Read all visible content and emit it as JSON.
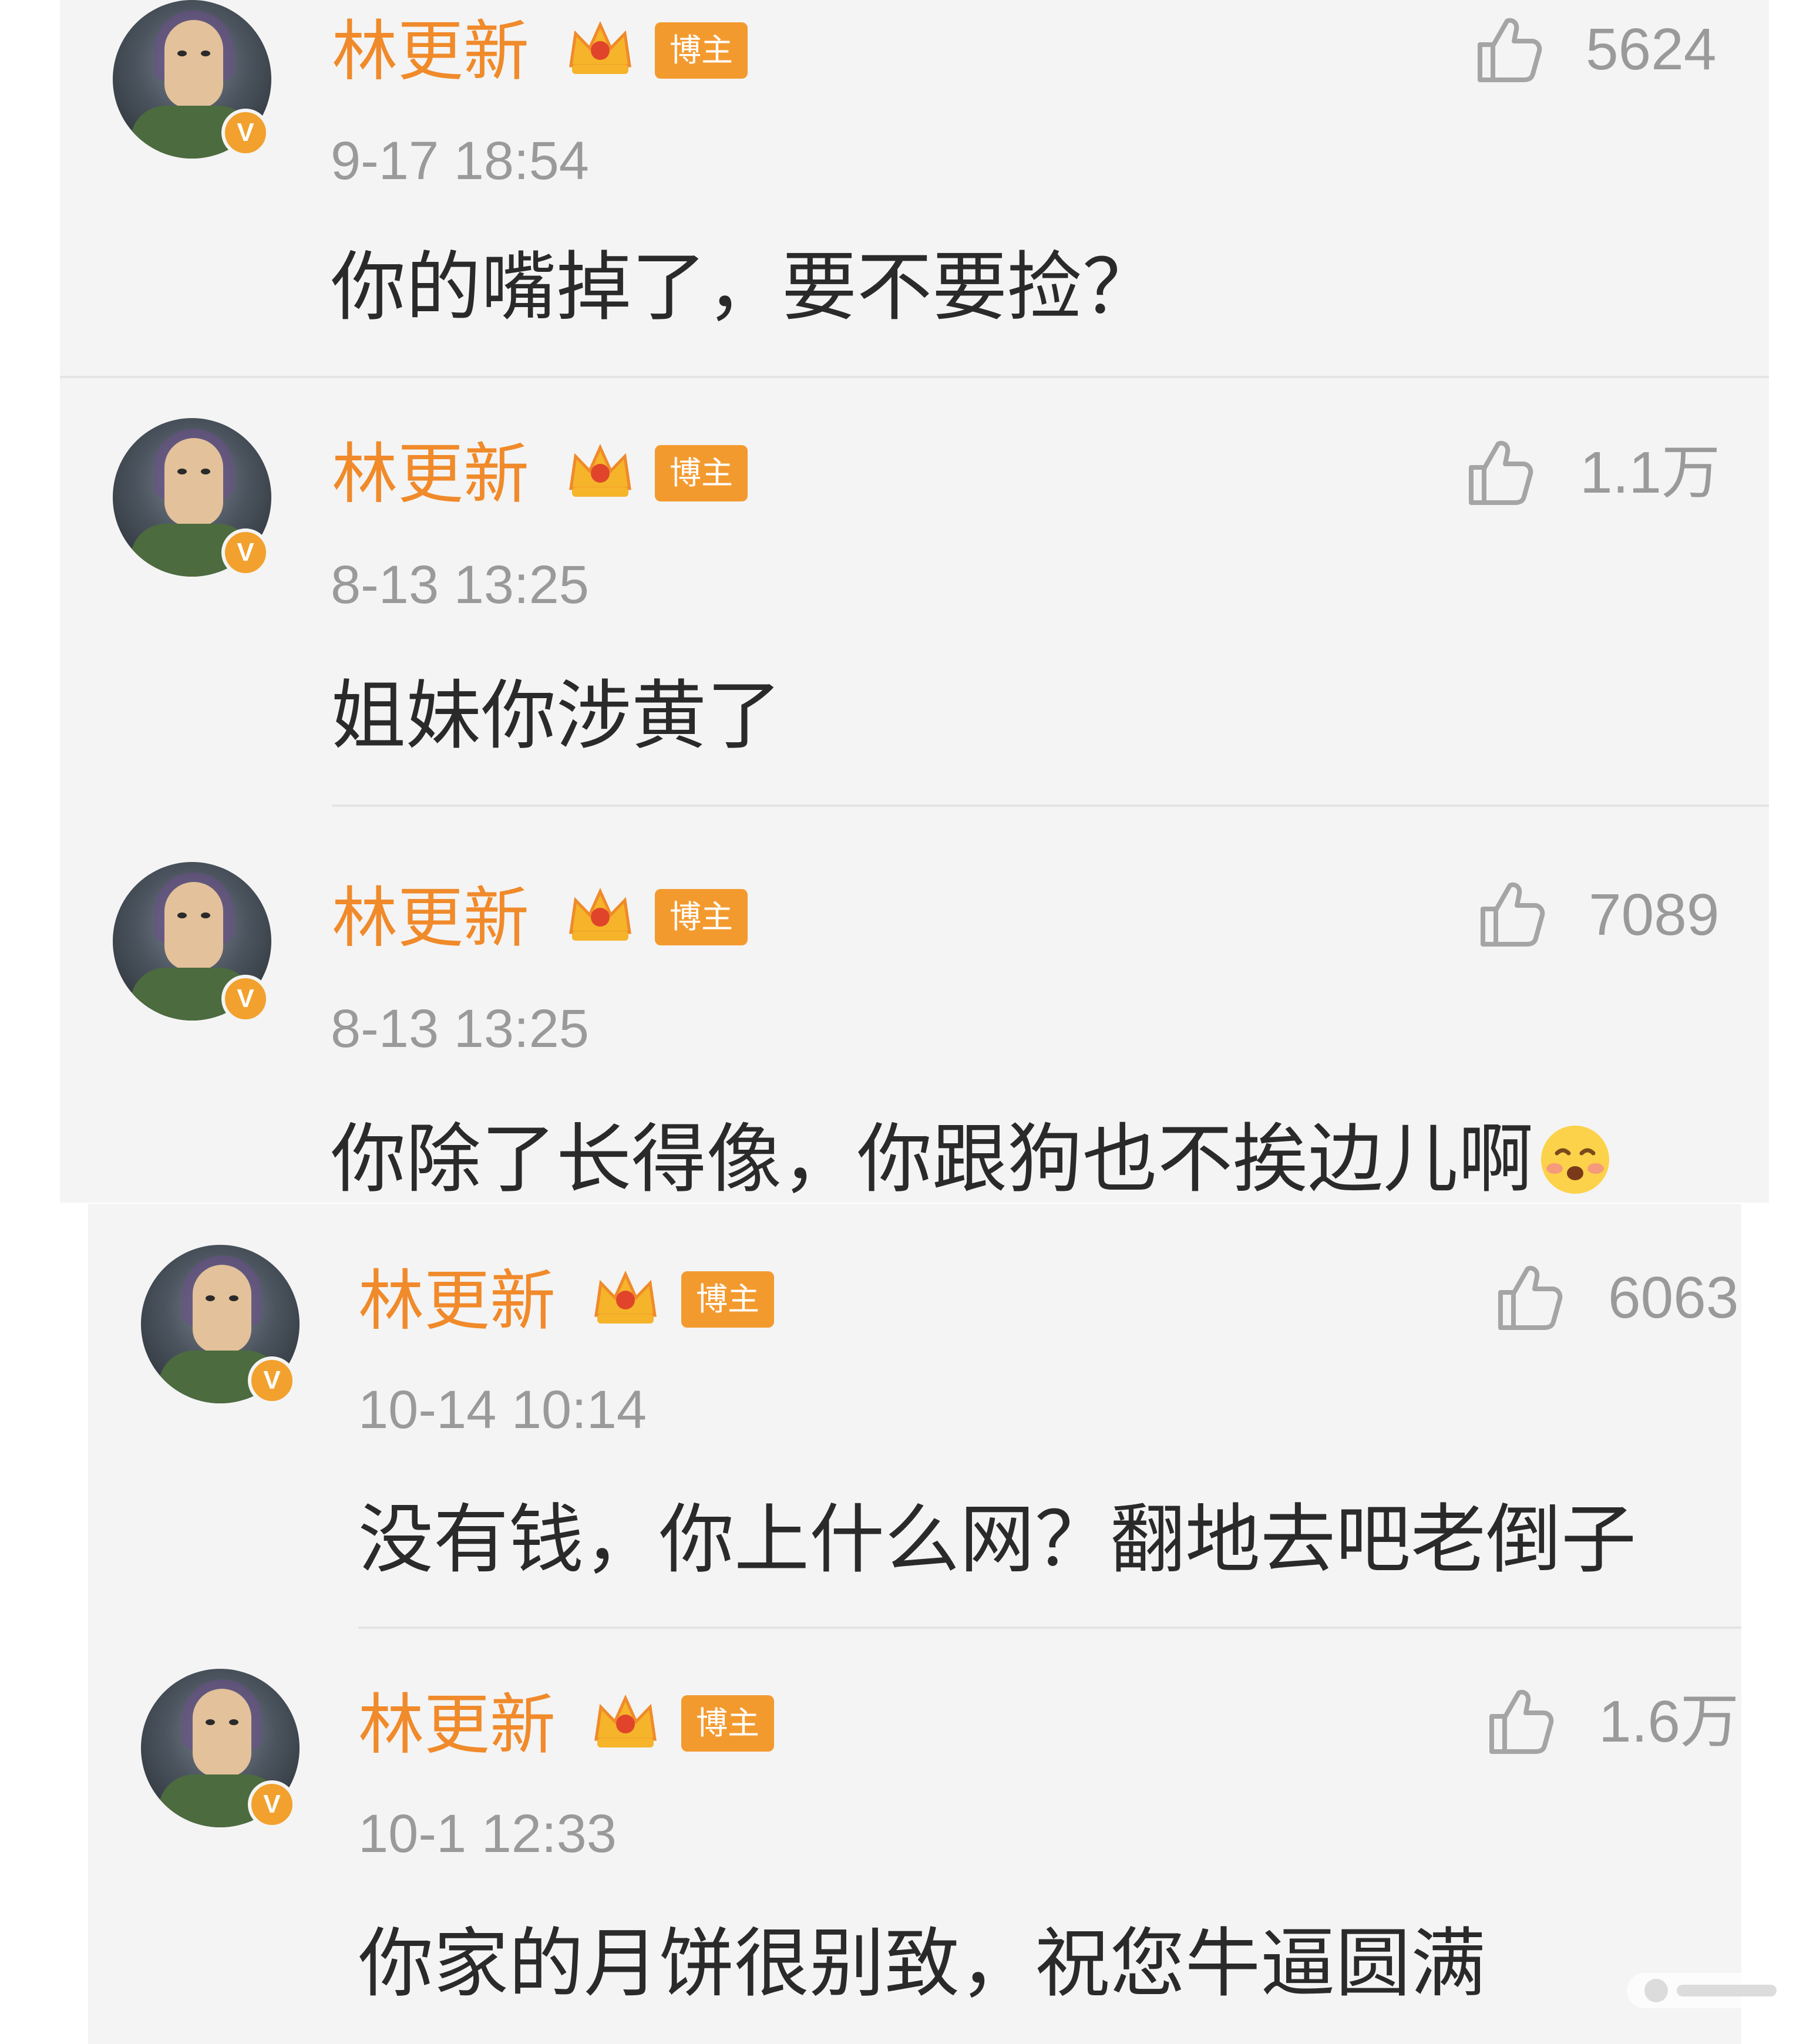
{
  "comments": [
    {
      "username": "林更新",
      "role_badge": "博主",
      "timestamp": "9-17 18:54",
      "likes": "5624",
      "text": "你的嘴掉了，要不要捡？"
    },
    {
      "username": "林更新",
      "role_badge": "博主",
      "timestamp": "8-13 13:25",
      "likes": "1.1万",
      "text": "姐妹你涉黄了"
    },
    {
      "username": "林更新",
      "role_badge": "博主",
      "timestamp": "8-13 13:25",
      "likes": "7089",
      "text": "你除了长得像，你跟狗也不挨边儿啊",
      "emoji": "blushing-face-emoji"
    },
    {
      "username": "林更新",
      "role_badge": "博主",
      "timestamp": "10-14 10:14",
      "likes": "6063",
      "text": "没有钱，你上什么网？翻地去吧老倒子"
    },
    {
      "username": "林更新",
      "role_badge": "博主",
      "timestamp": "10-1 12:33",
      "likes": "1.6万",
      "text": "你家的月饼很别致，祝您牛逼圆满"
    }
  ],
  "verified_badge": "V",
  "icons": {
    "like": "thumbs-up-icon",
    "crown": "crown-icon",
    "verified": "verified-v-icon"
  },
  "colors": {
    "username": "#f08a2a",
    "badge": "#f39a2f",
    "timestamp": "#9a9a9a",
    "text": "#2a2a2a",
    "panel": "#f4f4f4"
  }
}
